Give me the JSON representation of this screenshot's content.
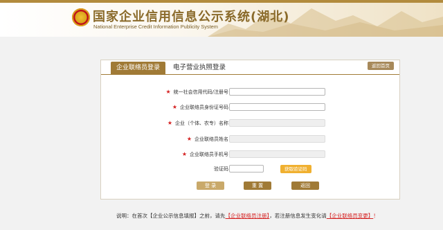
{
  "header": {
    "title": "国家企业信用信息公示系统(湖北)",
    "subtitle": "National Enterprise Credit Information Publicity System"
  },
  "tabs": [
    {
      "label": "企业联络员登录",
      "active": true
    },
    {
      "label": "电子营业执照登录",
      "active": false
    }
  ],
  "home_button": "返回首页",
  "form": {
    "credit_code_label": "统一社会信用代码/注册号",
    "id_number_label": "企业联络员身份证号码",
    "company_name_label": "企业（个体、农专）名称",
    "contact_name_label": "企业联络员姓名",
    "phone_label": "企业联络员手机号",
    "captcha_label": "验证码",
    "sms_button": "获取验证码"
  },
  "buttons": {
    "login": "登 录",
    "reset": "重 置",
    "back": "返回"
  },
  "notice": {
    "prefix": "说明：在首次【企业公示信息填报】之前，请先",
    "link1": "【企业联络员注册】",
    "middle": "，若注册信息发生变化请",
    "link2": "【企业联络员变更】",
    "suffix": "！"
  },
  "colors": {
    "brand_gold": "#a07a36",
    "light_gold": "#c9a96a",
    "orange": "#f0b030",
    "required_red": "#d42020"
  }
}
